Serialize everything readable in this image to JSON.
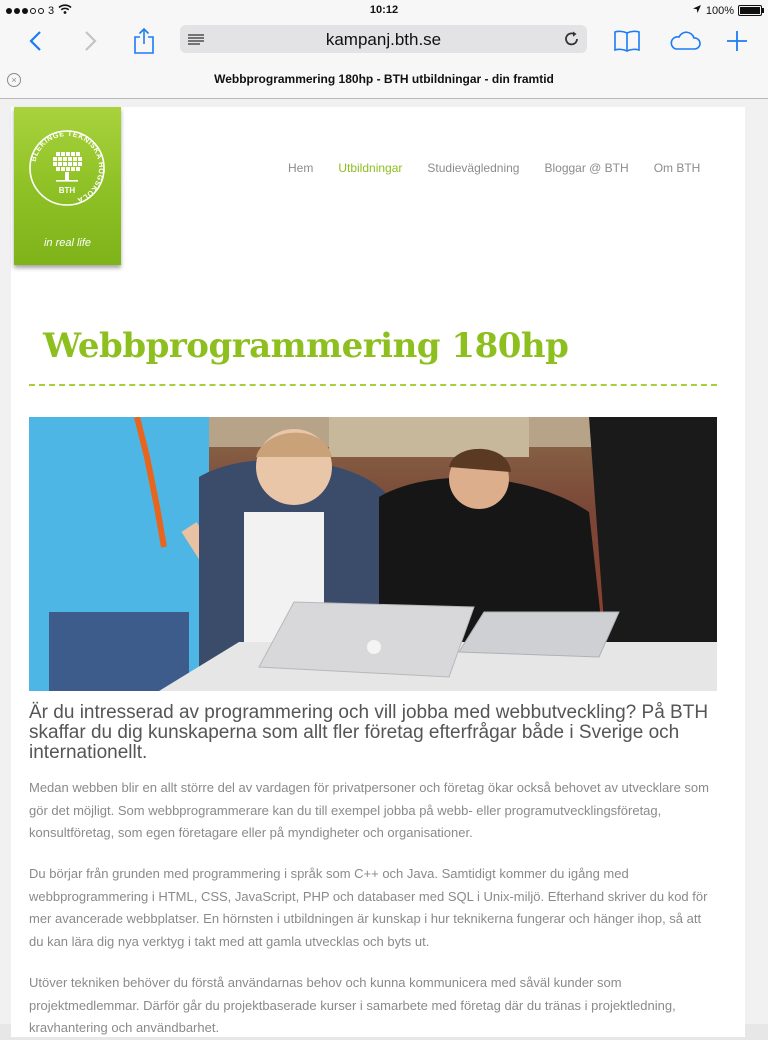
{
  "status": {
    "carrier": "3",
    "time": "10:12",
    "battery": "100%",
    "signal_bars_filled": 3,
    "signal_bars_total": 5
  },
  "browser": {
    "url": "kampanj.bth.se",
    "tab_title": "Webbprogrammering 180hp - BTH utbildningar - din framtid",
    "icons": [
      "back-icon",
      "forward-icon",
      "share-icon",
      "reader-icon",
      "reload-icon",
      "bookmarks-icon",
      "icloud-tabs-icon",
      "new-tab-icon"
    ]
  },
  "logo": {
    "ring_text": "BLEKINGE TEKNISKA HÖGSKOLA",
    "abbr": "BTH",
    "tagline": "in real life"
  },
  "nav": {
    "items": [
      "Hem",
      "Utbildningar",
      "Studievägledning",
      "Bloggar @ BTH",
      "Om BTH"
    ],
    "active": "Utbildningar"
  },
  "colors": {
    "accent": "#8dbf1e",
    "ios_blue": "#1b7cf5"
  },
  "page": {
    "title": "Webbprogrammering 180hp",
    "hero_alt": "Students working on laptops",
    "lead": "Är du intresserad av programmering och vill jobba med webbutveckling? På BTH skaffar du dig kunskaperna som allt fler företag efterfrågar både i Sverige och internationellt.",
    "paragraphs": [
      "Medan webben blir en allt större del av vardagen för privatpersoner och företag ökar också behovet av utvecklare som gör det möjligt. Som webbprogrammerare kan du till exempel jobba på webb- eller programutvecklingsföretag, konsultföretag, som egen företagare eller på myndigheter och organisationer.",
      "Du börjar från grunden med programmering i språk som C++ och Java. Samtidigt kommer du igång med webbprogrammering i HTML, CSS, JavaScript, PHP och databaser med SQL i Unix-miljö. Efterhand skriver du kod för mer avancerade webbplatser. En hörnsten i utbildningen är kunskap i hur teknikerna fungerar och hänger ihop, så att du kan lära dig nya verktyg i takt med att gamla utvecklas och byts ut.",
      "Utöver tekniken behöver du förstå användarnas behov och kunna kommunicera med såväl kunder som projektmedlemmar. Därför går du projektbaserade kurser i samarbete med företag där du tränas i projektledning, kravhantering och användbarhet."
    ]
  }
}
